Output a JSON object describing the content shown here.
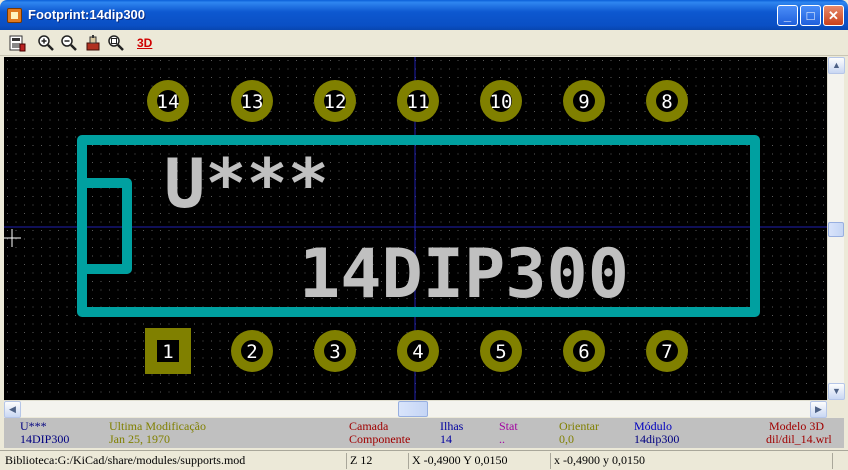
{
  "window": {
    "title": "Footprint:14dip300",
    "buttons": {
      "minimize": "_",
      "maximize": "□",
      "close": "✕"
    }
  },
  "toolbar": {
    "icons": [
      "load-module-icon",
      "zoom-in-icon",
      "zoom-out-icon",
      "redraw-icon",
      "zoom-fit-icon",
      "3d-view-icon"
    ],
    "label_3d": "3D"
  },
  "footprint": {
    "reference": "U***",
    "value": "14DIP300",
    "colors": {
      "pads": "#808000",
      "outline": "#00a0a0",
      "text": "#c0c0c0",
      "pin_labels": "#ffffff",
      "grid": "#606060",
      "axis": "#0000c0"
    },
    "pads_top": [
      "14",
      "13",
      "12",
      "11",
      "10",
      "9",
      "8"
    ],
    "pads_bottom": [
      "1",
      "2",
      "3",
      "4",
      "5",
      "6",
      "7"
    ]
  },
  "info": {
    "ref_header": "U***",
    "ref_value": "14DIP300",
    "modified_header": "Ultima Modificação",
    "modified_value": "Jan 25, 1970",
    "layer_header": "Camada",
    "layer_value": "Componente",
    "pads_header": "Ilhas",
    "pads_value": "14",
    "stat_header": "Stat",
    "stat_value": "..",
    "orient_header": "Orientar",
    "orient_value": "0,0",
    "module_header": "Módulo",
    "module_value": "14dip300",
    "model3d_header": "Modelo 3D",
    "model3d_value": "dil/dil_14.wrl"
  },
  "status": {
    "library": "Biblioteca:G:/KiCad/share/modules/supports.mod",
    "zoom": "Z 12",
    "abs_coords": "X -0,4900  Y 0,0150",
    "rel_coords": "x -0,4900  y 0,0150"
  }
}
